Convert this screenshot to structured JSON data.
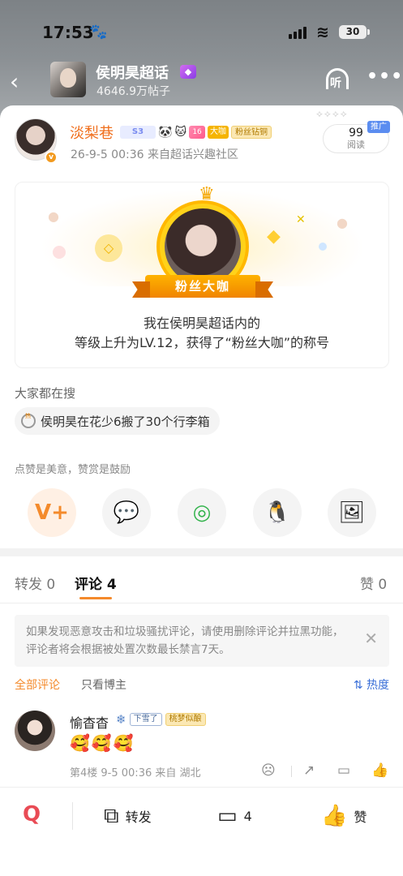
{
  "status": {
    "time": "17:53",
    "battery": "30"
  },
  "header": {
    "title": "侯明昊超话",
    "subtitle": "4646.9万帖子",
    "listen_label": "听"
  },
  "post": {
    "author": "淡梨巷",
    "meta": "26-9-5 00:36  来自超话兴趣社区",
    "read_count": "99",
    "read_label": "阅读",
    "promo_tag": "推广",
    "badges": {
      "svip": "S3",
      "dk": "大咖",
      "fan": "粉丝钻铜",
      "lv": "16"
    }
  },
  "level_card": {
    "ribbon": "粉丝大咖",
    "line1": "我在侯明昊超话内的",
    "line2": "等级上升为LV.12，获得了“粉丝大咖”的称号"
  },
  "search": {
    "label": "大家都在搜",
    "query": "侯明昊在花少6搬了30个行李箱"
  },
  "reward": {
    "label": "点赞是美意，赞赏是鼓励"
  },
  "share_buttons": [
    {
      "name": "reward-v-plus",
      "glyph": "V+"
    },
    {
      "name": "wechat",
      "glyph": "💬"
    },
    {
      "name": "moments",
      "glyph": "◎"
    },
    {
      "name": "qq",
      "glyph": "🐧"
    },
    {
      "name": "save-image",
      "glyph": "🖼"
    }
  ],
  "tabs": {
    "repost": "转发 0",
    "comments": "评论 4",
    "likes": "赞 0"
  },
  "notice": {
    "text": "如果发现恶意攻击和垃圾骚扰评论，请使用删除评论并拉黑功能，评论者将会根据被处置次数最长禁言7天。"
  },
  "filters": {
    "all": "全部评论",
    "owner_only": "只看博主",
    "sort": "热度"
  },
  "comment": {
    "name": "愉杳杳",
    "tag1": "下雪了",
    "tag2": "桃梦似酿",
    "content": "🥰🥰🥰",
    "meta": "第4楼  9-5 00:36  来自 湖北"
  },
  "bottom_bar": {
    "repost": "转发",
    "comment_count": "4",
    "like": "赞"
  }
}
